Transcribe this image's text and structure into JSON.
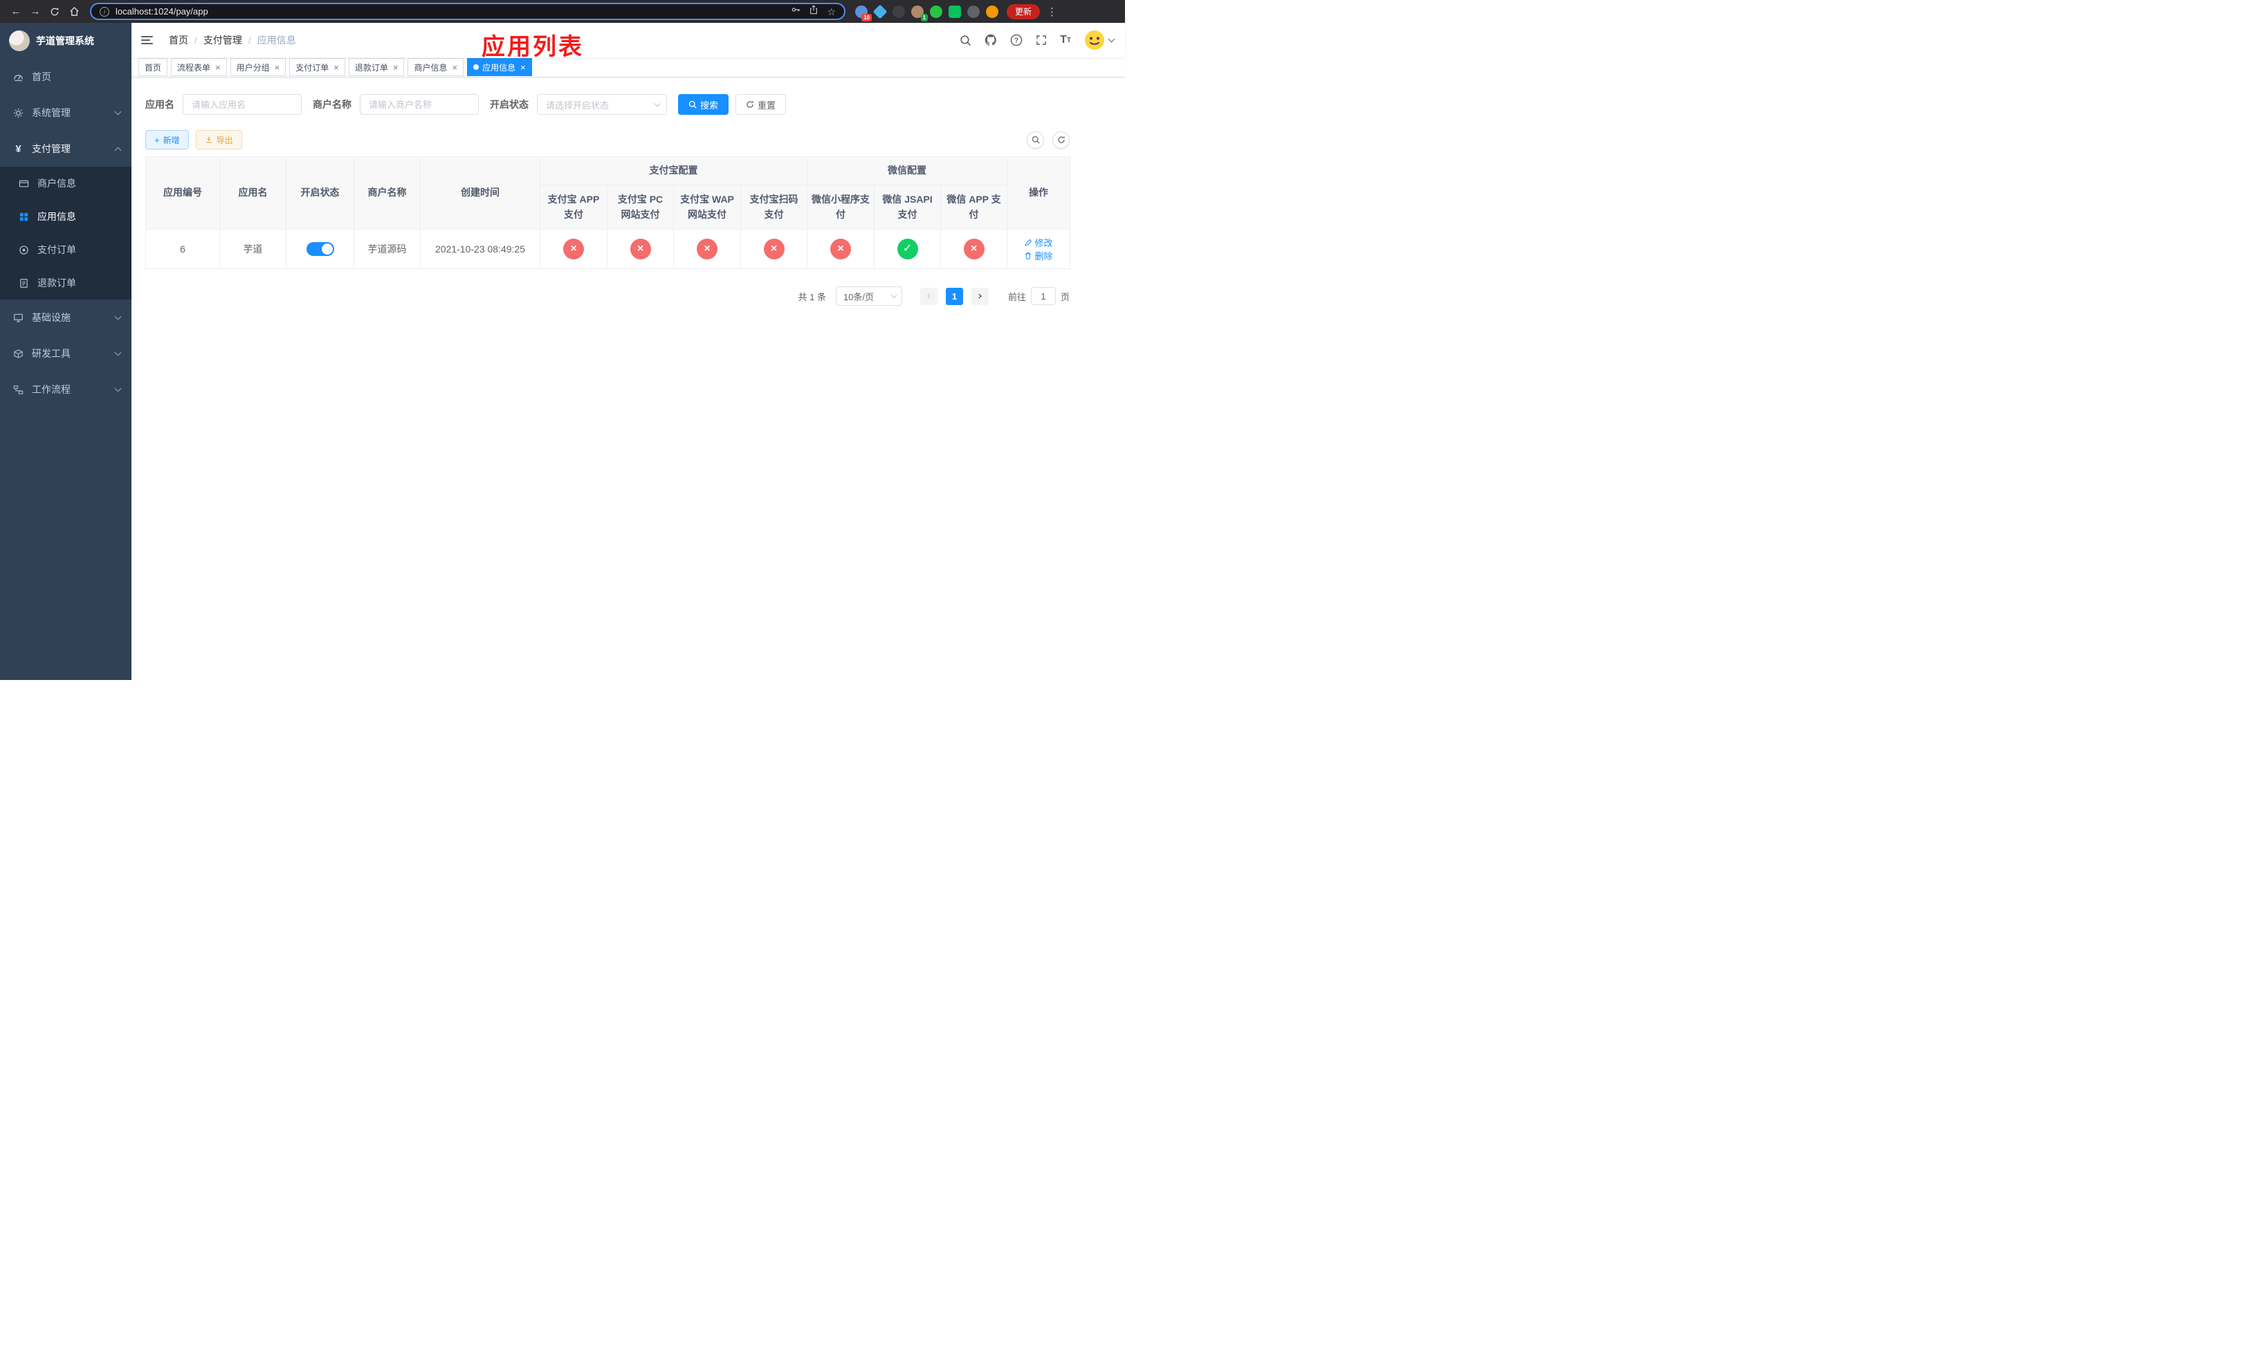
{
  "colors": {
    "accent": "#1890ff",
    "danger": "#f56c6c",
    "success": "#13ce66",
    "sidebar_bg": "#304156",
    "submenu_bg": "#1f2d3d"
  },
  "browser": {
    "url": "localhost:1024/pay/app",
    "update_label": "更新",
    "extensions": [
      {
        "id": "ext-1",
        "color": "#5f8fd9",
        "shape": "circle",
        "badge": "10",
        "badge_color": "#e8453c"
      },
      {
        "id": "ext-2",
        "color": "#46b1e8",
        "shape": "diamond"
      },
      {
        "id": "ext-3",
        "color": "#3c4043",
        "shape": "circle"
      },
      {
        "id": "ext-4",
        "color": "#b08968",
        "shape": "circle",
        "badge": "1",
        "badge_color": "#1ea446"
      },
      {
        "id": "ext-5",
        "color": "#28c445",
        "shape": "circle"
      },
      {
        "id": "ext-6",
        "color": "#07c160",
        "shape": "square"
      },
      {
        "id": "ext-7",
        "color": "#5f6368",
        "shape": "circle"
      },
      {
        "id": "ext-8",
        "color": "#f29900",
        "shape": "circle"
      }
    ]
  },
  "sidebar": {
    "logo_title": "芋道管理系统",
    "menu": [
      {
        "id": "home",
        "label": "首页",
        "icon": "dashboard-icon",
        "type": "item"
      },
      {
        "id": "system",
        "label": "系统管理",
        "icon": "gear-icon",
        "type": "group",
        "expanded": false
      },
      {
        "id": "payment",
        "label": "支付管理",
        "icon": "yen-icon",
        "type": "group",
        "expanded": true,
        "children": [
          {
            "id": "merchant-info",
            "label": "商户信息",
            "icon": "merchant-card-icon",
            "active": false
          },
          {
            "id": "app-info",
            "label": "应用信息",
            "icon": "app-grid-icon",
            "active": true
          },
          {
            "id": "pay-order",
            "label": "支付订单",
            "icon": "order-icon",
            "active": false
          },
          {
            "id": "refund-order",
            "label": "退款订单",
            "icon": "refund-doc-icon",
            "active": false
          }
        ]
      },
      {
        "id": "infrastructure",
        "label": "基础设施",
        "icon": "infra-icon",
        "type": "group",
        "expanded": false
      },
      {
        "id": "dev-tools",
        "label": "研发工具",
        "icon": "tools-icon",
        "type": "group",
        "expanded": false
      },
      {
        "id": "workflow",
        "label": "工作流程",
        "icon": "workflow-icon",
        "type": "group",
        "expanded": false
      }
    ]
  },
  "navbar": {
    "breadcrumb": [
      "首页",
      "支付管理",
      "应用信息"
    ],
    "annotation": "应用列表"
  },
  "tags": [
    {
      "id": "home",
      "label": "首页",
      "closable": false,
      "active": false
    },
    {
      "id": "flow-form",
      "label": "流程表单",
      "closable": true,
      "active": false
    },
    {
      "id": "user-group",
      "label": "用户分组",
      "closable": true,
      "active": false
    },
    {
      "id": "pay-order",
      "label": "支付订单",
      "closable": true,
      "active": false
    },
    {
      "id": "refund-order",
      "label": "退款订单",
      "closable": true,
      "active": false
    },
    {
      "id": "merchant-info",
      "label": "商户信息",
      "closable": true,
      "active": false
    },
    {
      "id": "app-info",
      "label": "应用信息",
      "closable": true,
      "active": true
    }
  ],
  "filters": {
    "app_name_label": "应用名",
    "app_name_placeholder": "请输入应用名",
    "merchant_label": "商户名称",
    "merchant_placeholder": "请输入商户名称",
    "status_label": "开启状态",
    "status_placeholder": "请选择开启状态",
    "search_label": "搜索",
    "reset_label": "重置"
  },
  "toolbar": {
    "add_label": "新增",
    "export_label": "导出"
  },
  "table": {
    "headers": {
      "app_id": "应用编号",
      "app_name": "应用名",
      "status": "开启状态",
      "merchant": "商户名称",
      "created": "创建时间",
      "alipay_group": "支付宝配置",
      "wechat_group": "微信配置",
      "ops": "操作",
      "channels": [
        "支付宝 APP 支付",
        "支付宝 PC 网站支付",
        "支付宝 WAP 网站支付",
        "支付宝扫码支付",
        "微信小程序支付",
        "微信 JSAPI 支付",
        "微信 APP 支付"
      ]
    },
    "rows": [
      {
        "app_id": "6",
        "app_name": "芋道",
        "status_on": true,
        "merchant": "芋道源码",
        "created": "2021-10-23 08:49:25",
        "channels": [
          "off",
          "off",
          "off",
          "off",
          "off",
          "on",
          "off"
        ],
        "edit_label": "修改",
        "delete_label": "删除"
      }
    ]
  },
  "pagination": {
    "total": "共 1 条",
    "page_size": "10条/页",
    "current": "1",
    "goto_label": "前往",
    "goto_value": "1",
    "page_label": "页"
  }
}
